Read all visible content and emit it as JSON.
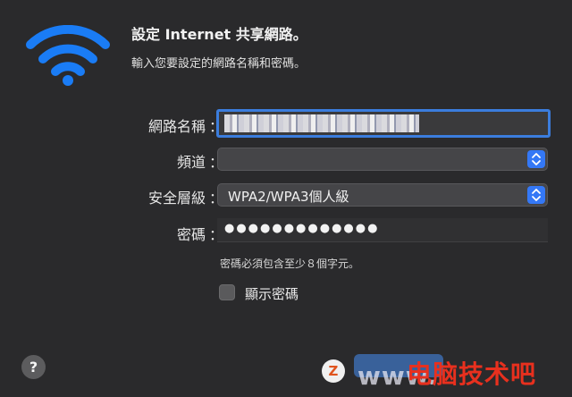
{
  "header": {
    "title": "設定 Internet 共享網路。",
    "subtitle": "輸入您要設定的網路名稱和密碼。"
  },
  "form": {
    "network_name_label": "網路名稱",
    "channel_label": "頻道",
    "security_label": "安全層級",
    "security_value": "WPA2/WPA3個人級",
    "password_label": "密碼",
    "colon": "：",
    "password_dots": "●●●●●●●●●●●●●",
    "hint": "密碼必須包含至少８個字元。",
    "show_password_label": "顯示密碼"
  },
  "footer": {
    "help_label": "?"
  },
  "watermark": {
    "logo": "Z",
    "url": "www.",
    "text": "电脑技术吧"
  },
  "colors": {
    "accent": "#3478f6",
    "wifi": "#1a7cf5",
    "background": "#2a2a2c"
  }
}
